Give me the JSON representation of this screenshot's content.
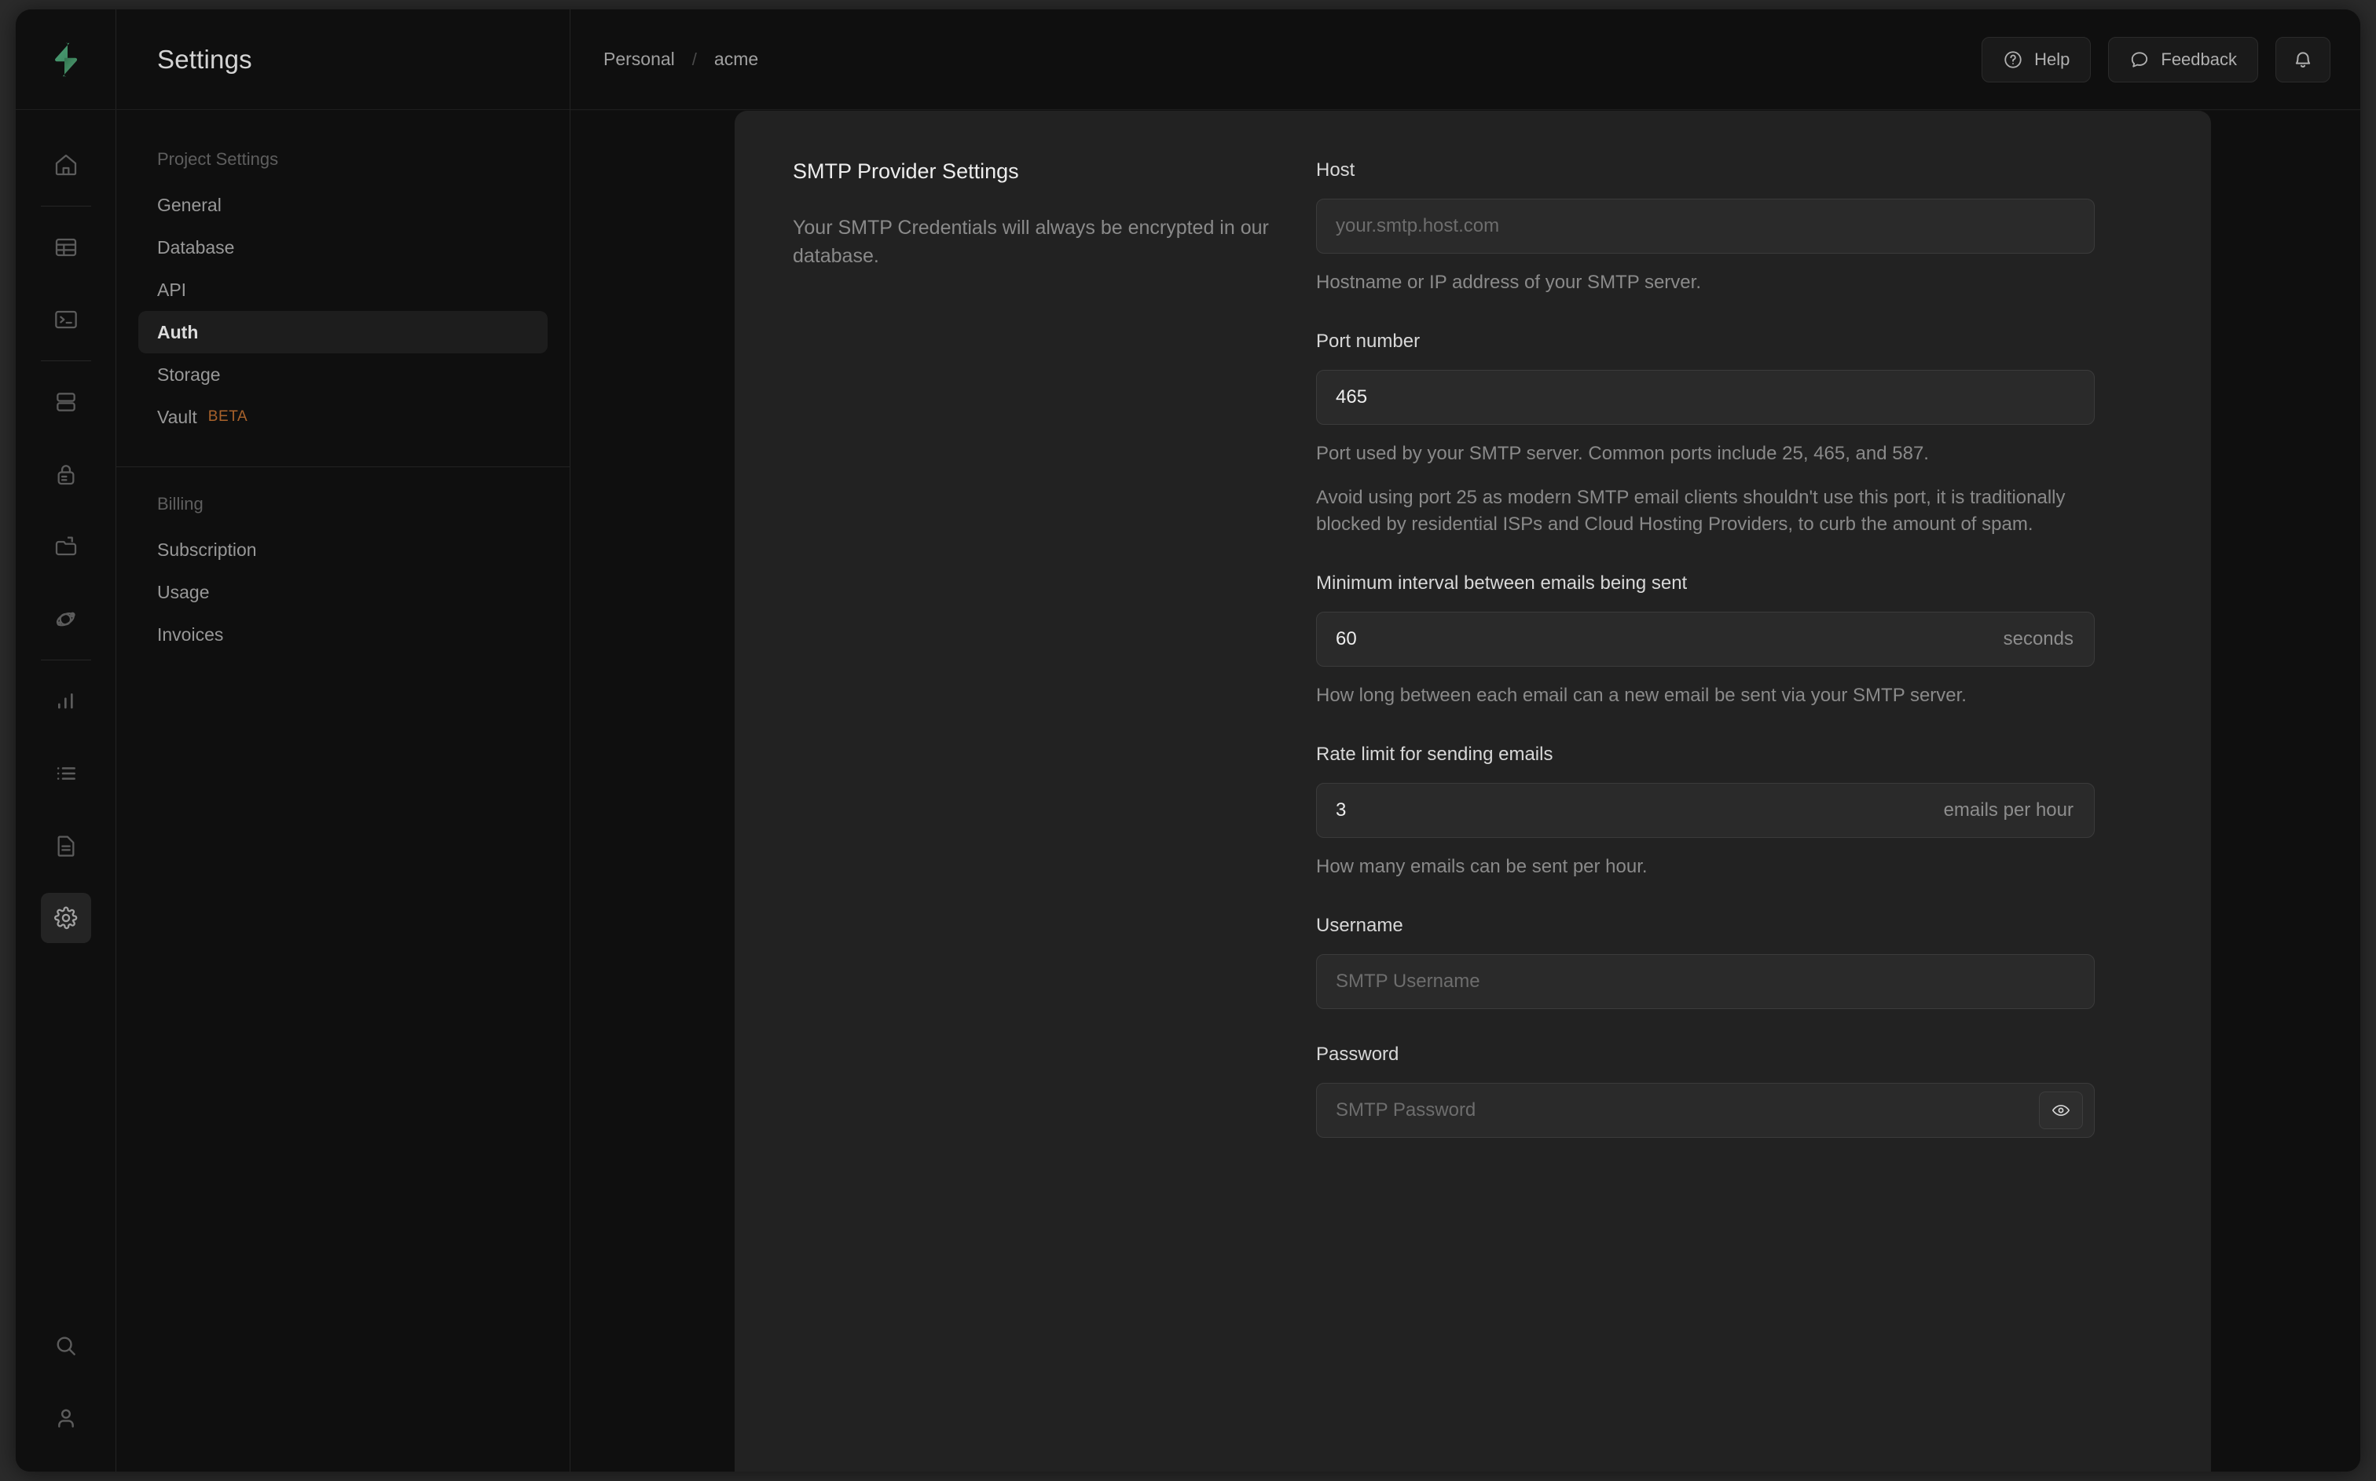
{
  "app": {
    "logo": "supabase-lightning-logo",
    "brand_green": "#3ECF8E"
  },
  "rail": {
    "items": [
      {
        "name": "home",
        "icon": "home-icon"
      },
      {
        "name": "table-editor",
        "icon": "table-icon"
      },
      {
        "name": "sql-editor",
        "icon": "terminal-icon"
      },
      {
        "name": "database",
        "icon": "database-icon"
      },
      {
        "name": "authentication",
        "icon": "lock-icon"
      },
      {
        "name": "storage",
        "icon": "folder-icon"
      },
      {
        "name": "edge-functions",
        "icon": "atom-icon"
      },
      {
        "name": "reports",
        "icon": "bar-chart-icon"
      },
      {
        "name": "logs",
        "icon": "list-icon"
      },
      {
        "name": "api-docs",
        "icon": "document-icon"
      },
      {
        "name": "settings",
        "icon": "gear-icon",
        "active": true
      }
    ],
    "bottom_items": [
      {
        "name": "search",
        "icon": "search-icon"
      },
      {
        "name": "account",
        "icon": "user-icon"
      }
    ]
  },
  "sidebar": {
    "title": "Settings",
    "groups": [
      {
        "label": "Project Settings",
        "items": [
          {
            "label": "General",
            "active": false
          },
          {
            "label": "Database",
            "active": false
          },
          {
            "label": "API",
            "active": false
          },
          {
            "label": "Auth",
            "active": true
          },
          {
            "label": "Storage",
            "active": false
          },
          {
            "label": "Vault",
            "active": false,
            "badge": "BETA"
          }
        ]
      },
      {
        "label": "Billing",
        "items": [
          {
            "label": "Subscription",
            "active": false
          },
          {
            "label": "Usage",
            "active": false
          },
          {
            "label": "Invoices",
            "active": false
          }
        ]
      }
    ]
  },
  "topbar": {
    "breadcrumbs": [
      {
        "label": "Personal"
      },
      {
        "label": "acme"
      }
    ],
    "separator": "/",
    "help_label": "Help",
    "feedback_label": "Feedback",
    "notifications_name": "notifications"
  },
  "main": {
    "section_title": "SMTP Provider Settings",
    "section_description": "Your SMTP Credentials will always be encrypted in our database.",
    "fields": [
      {
        "key": "host",
        "label": "Host",
        "value": "",
        "placeholder": "your.smtp.host.com",
        "suffix": "",
        "help": [
          "Hostname or IP address of your SMTP server."
        ]
      },
      {
        "key": "port",
        "label": "Port number",
        "value": "465",
        "placeholder": "",
        "suffix": "",
        "help": [
          "Port used by your SMTP server. Common ports include 25, 465, and 587.",
          "Avoid using port 25 as modern SMTP email clients shouldn't use this port, it is traditionally blocked by residential ISPs and Cloud Hosting Providers, to curb the amount of spam."
        ]
      },
      {
        "key": "interval",
        "label": "Minimum interval between emails being sent",
        "value": "60",
        "placeholder": "",
        "suffix": "seconds",
        "help": [
          "How long between each email can a new email be sent via your SMTP server."
        ]
      },
      {
        "key": "rate_limit",
        "label": "Rate limit for sending emails",
        "value": "3",
        "placeholder": "",
        "suffix": "emails per hour",
        "help": [
          "How many emails can be sent per hour."
        ]
      },
      {
        "key": "username",
        "label": "Username",
        "value": "",
        "placeholder": "SMTP Username",
        "suffix": "",
        "help": []
      },
      {
        "key": "password",
        "label": "Password",
        "value": "",
        "placeholder": "SMTP Password",
        "suffix": "",
        "reveal_icon": "eye-icon",
        "help": []
      }
    ]
  }
}
